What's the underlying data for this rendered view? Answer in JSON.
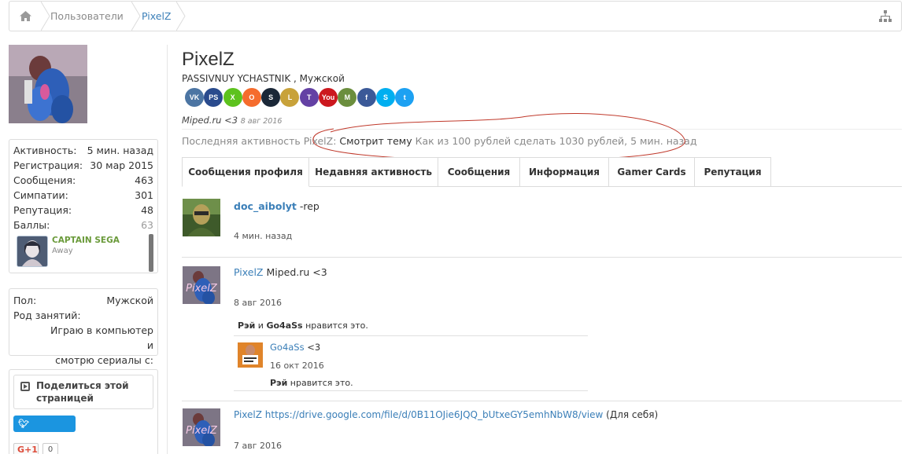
{
  "breadcrumb": {
    "home_icon": "home-icon",
    "items": [
      "Пользователи",
      "PixelZ"
    ],
    "sitemap_icon": "sitemap-icon"
  },
  "profile": {
    "name": "PixelZ",
    "subtitle": "PASSIVNUY YCHASTNIK , Мужской",
    "status_text": "Miped.ru <3",
    "status_date": "8 авг 2016",
    "last_activity_label": "Последняя активность PixelZ:",
    "last_activity_action": "Смотрит тему",
    "last_activity_thread": "Как из 100 рублей сделать 1030 рублей",
    "last_activity_time": ", 5 мин. назад",
    "social": [
      {
        "name": "vk",
        "label": "VK",
        "color": "#4c75a3"
      },
      {
        "name": "playstation",
        "label": "PS",
        "color": "#2a4b8d"
      },
      {
        "name": "xbox",
        "label": "X",
        "color": "#5dc21e"
      },
      {
        "name": "origin",
        "label": "O",
        "color": "#f56c2d"
      },
      {
        "name": "steam",
        "label": "S",
        "color": "#1b2838"
      },
      {
        "name": "league",
        "label": "L",
        "color": "#c8a23a"
      },
      {
        "name": "twitch",
        "label": "T",
        "color": "#6441a4"
      },
      {
        "name": "youtube",
        "label": "You",
        "color": "#cc181e"
      },
      {
        "name": "minecraft",
        "label": "M",
        "color": "#6b8e3d"
      },
      {
        "name": "facebook",
        "label": "f",
        "color": "#3b5998"
      },
      {
        "name": "skype",
        "label": "S",
        "color": "#00aff0"
      },
      {
        "name": "twitter",
        "label": "t",
        "color": "#1da1f2"
      }
    ]
  },
  "stats": [
    {
      "label": "Активность:",
      "value": "5 мин. назад"
    },
    {
      "label": "Регистрация:",
      "value": "30 мар 2015"
    },
    {
      "label": "Сообщения:",
      "value": "463"
    },
    {
      "label": "Симпатии:",
      "value": "301"
    },
    {
      "label": "Репутация:",
      "value": "48"
    },
    {
      "label": "Баллы:",
      "value": "63"
    }
  ],
  "friend": {
    "name": "CAPTAIN SEGA",
    "status": "Away"
  },
  "about": {
    "gender_label": "Пол:",
    "gender_value": "Мужской",
    "occupation_label": "Род занятий:",
    "occupation_value_1": "Играю в компьютер и",
    "occupation_value_2": "смотрю сериалы с:"
  },
  "share": {
    "title": "Поделиться этой страницей",
    "tweet_label": "Твитнуть",
    "gplus_label": "G+1",
    "gplus_count": "0"
  },
  "tabs": [
    "Сообщения профиля",
    "Недавняя активность",
    "Сообщения",
    "Информация",
    "Gamer Cards",
    "Репутация"
  ],
  "posts": [
    {
      "user": "doc_aibolyt",
      "text": " -rep",
      "date": "4 мин. назад"
    },
    {
      "user": "PixelZ",
      "text": " Miped.ru <3",
      "date": "8 авг 2016",
      "likes_user1": "Рэй",
      "likes_and": " и ",
      "likes_user2": "Go4aSs",
      "likes_suffix": " нравится это.",
      "comment": {
        "user": "Go4aSs",
        "text": " <3",
        "date": "16 окт 2016",
        "likes_user": "Рэй",
        "likes_suffix": " нравится это."
      }
    },
    {
      "user": "PixelZ",
      "link": " https://drive.google.com/file/d/0B11OJie6JQQ_bUtxeGY5emhNbW8/view",
      "text": " (Для себя)",
      "date": "7 авг 2016"
    }
  ]
}
